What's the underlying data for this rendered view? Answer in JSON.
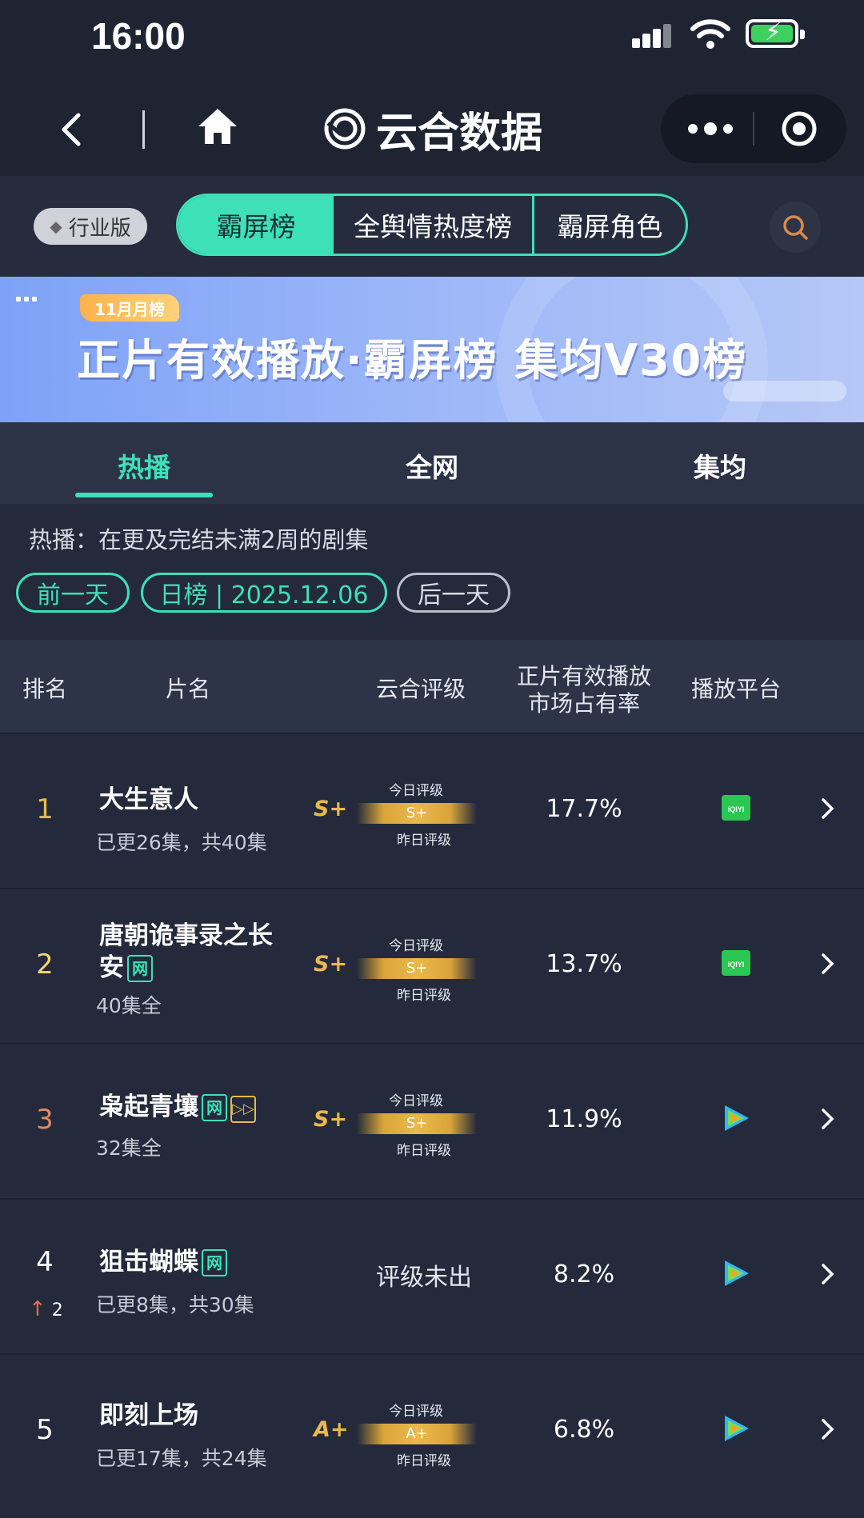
{
  "status_bar": {
    "time": "16:00"
  },
  "nav": {
    "brand": "云合数据"
  },
  "filter": {
    "edition_label": "行业版",
    "segments": [
      "霸屏榜",
      "全舆情热度榜",
      "霸屏角色"
    ]
  },
  "banner": {
    "badge": "11月月榜",
    "title": "正片有效播放·霸屏榜 集均V30榜"
  },
  "tabs": [
    "热播",
    "全网",
    "集均"
  ],
  "note": "热播：在更及完结未满2周的剧集",
  "date_nav": {
    "prev": "前一天",
    "current": "日榜 | 2025.12.06",
    "next": "后一天"
  },
  "table": {
    "headers": {
      "rank": "排名",
      "title": "片名",
      "grade": "云合评级",
      "share_line1": "正片有效播放",
      "share_line2": "市场占有率",
      "platform": "播放平台"
    },
    "gauge_labels": {
      "today": "今日评级",
      "yesterday": "昨日评级"
    },
    "rows": [
      {
        "rank": "1",
        "title": "大生意人",
        "episodes": "已更26集，共40集",
        "tags": [],
        "grade": "S+",
        "gauge_value": "S+",
        "share": "17.7%",
        "platform": "iQIYI",
        "rank_color": "#e9b94b"
      },
      {
        "rank": "2",
        "title_line1": "唐朝诡事录之长",
        "title_line2": "安",
        "episodes": "40集全",
        "tags": [
          "网"
        ],
        "grade": "S+",
        "gauge_value": "S+",
        "share": "13.7%",
        "platform": "iQIYI",
        "rank_color": "#f2d77a"
      },
      {
        "rank": "3",
        "title": "枭起青壤",
        "episodes": "32集全",
        "tags": [
          "网",
          "▷▷"
        ],
        "grade": "S+",
        "gauge_value": "S+",
        "share": "11.9%",
        "platform": "Tencent Video",
        "rank_color": "#e08a66"
      },
      {
        "rank": "4",
        "title": "狙击蝴蝶",
        "episodes": "已更8集，共30集",
        "tags": [
          "网"
        ],
        "grade": "评级未出",
        "share": "8.2%",
        "platform": "Tencent Video",
        "trend": "2",
        "rank_color": "#ffffff"
      },
      {
        "rank": "5",
        "title": "即刻上场",
        "episodes": "已更17集，共24集",
        "tags": [],
        "grade": "A+",
        "gauge_value": "A+",
        "share": "6.8%",
        "platform": "Tencent Video",
        "rank_color": "#ffffff"
      }
    ]
  },
  "colors": {
    "accent": "#3ee0b8",
    "gold": "#e9b94b",
    "background": "#232839"
  }
}
